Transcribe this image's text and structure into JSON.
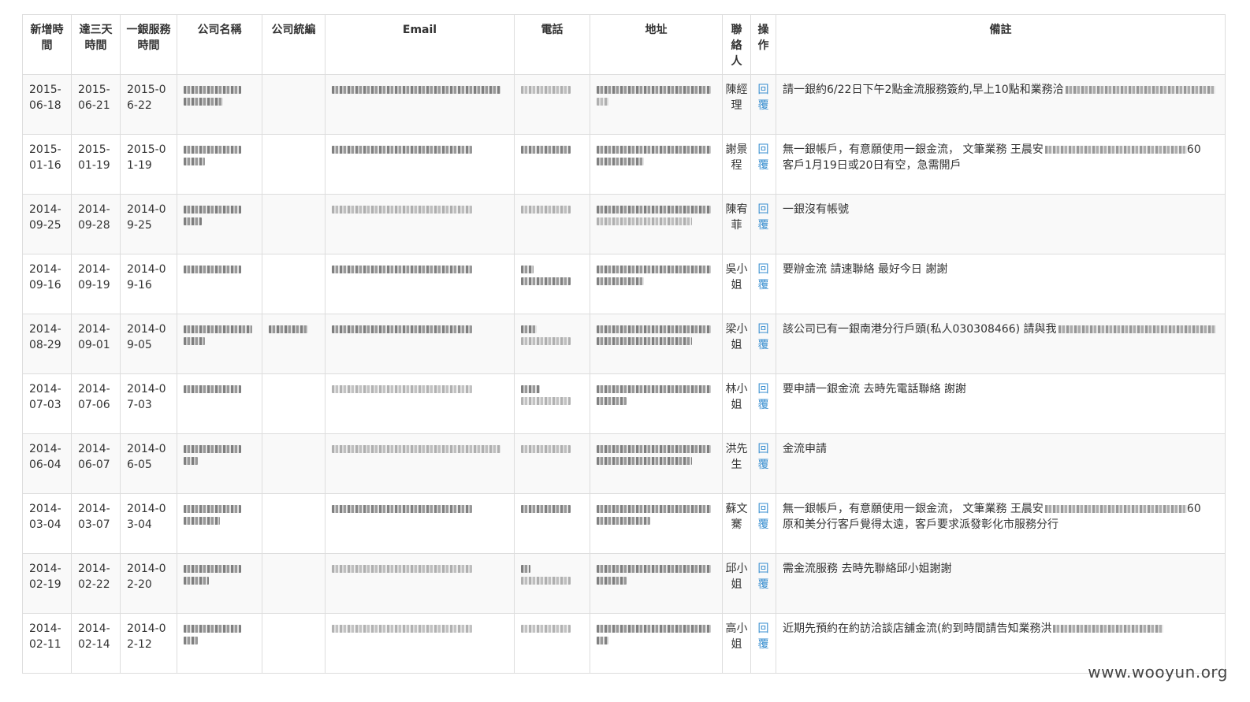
{
  "columns": [
    "新增時間",
    "達三天時間",
    "一銀服務時間",
    "公司名稱",
    "公司統編",
    "Email",
    "電話",
    "地址",
    "聯絡人",
    "操作",
    "備註"
  ],
  "rows": [
    {
      "added": "2015-06-18",
      "three_days": "2015-06-21",
      "service": "2015-06-22",
      "tax_id": "",
      "contact": "陳經理",
      "action": "回覆",
      "note": "請一銀約6/22日下午2點金流服務簽約,早上10點和業務洽"
    },
    {
      "added": "2015-01-16",
      "three_days": "2015-01-19",
      "service": "2015-01-19",
      "tax_id": "",
      "contact": "謝景程",
      "action": "回覆",
      "note": "無一銀帳戶，有意願使用一銀金流， 文筆業務 王晨安",
      "note_tail": "60",
      "note2": "客戶1月19日或20日有空，急需開戶"
    },
    {
      "added": "2014-09-25",
      "three_days": "2014-09-28",
      "service": "2014-09-25",
      "tax_id": "",
      "contact": "陳宥菲",
      "action": "回覆",
      "note": "一銀沒有帳號"
    },
    {
      "added": "2014-09-16",
      "three_days": "2014-09-19",
      "service": "2014-09-16",
      "tax_id": "",
      "contact": "吳小姐",
      "action": "回覆",
      "note": "要辦金流 請速聯絡 最好今日 謝謝"
    },
    {
      "added": "2014-08-29",
      "three_days": "2014-09-01",
      "service": "2014-09-05",
      "tax_id": "",
      "contact": "梁小姐",
      "action": "回覆",
      "note": "該公司已有一銀南港分行戶頭(私人030308466) 請與我"
    },
    {
      "added": "2014-07-03",
      "three_days": "2014-07-06",
      "service": "2014-07-03",
      "tax_id": "",
      "contact": "林小姐",
      "action": "回覆",
      "note": "要申請一銀金流 去時先電話聯絡 謝謝"
    },
    {
      "added": "2014-06-04",
      "three_days": "2014-06-07",
      "service": "2014-06-05",
      "tax_id": "",
      "contact": "洪先生",
      "action": "回覆",
      "note": "金流申請"
    },
    {
      "added": "2014-03-04",
      "three_days": "2014-03-07",
      "service": "2014-03-04",
      "tax_id": "",
      "contact": "蘇文騫",
      "action": "回覆",
      "note": "無一銀帳戶，有意願使用一銀金流， 文筆業務 王晨安",
      "note_tail": "60",
      "note2": "原和美分行客戶覺得太遠，客戶要求派發彰化市服務分行"
    },
    {
      "added": "2014-02-19",
      "three_days": "2014-02-22",
      "service": "2014-02-20",
      "tax_id": "",
      "contact": "邱小姐",
      "action": "回覆",
      "note": "需金流服務 去時先聯絡邱小姐謝謝"
    },
    {
      "added": "2014-02-11",
      "three_days": "2014-02-14",
      "service": "2014-02-12",
      "tax_id": "",
      "contact": "高小姐",
      "action": "回覆",
      "note": "近期先預約在約訪洽談店舖金流(約到時間請告知業務洪"
    }
  ],
  "watermark": "www.wooyun.org"
}
